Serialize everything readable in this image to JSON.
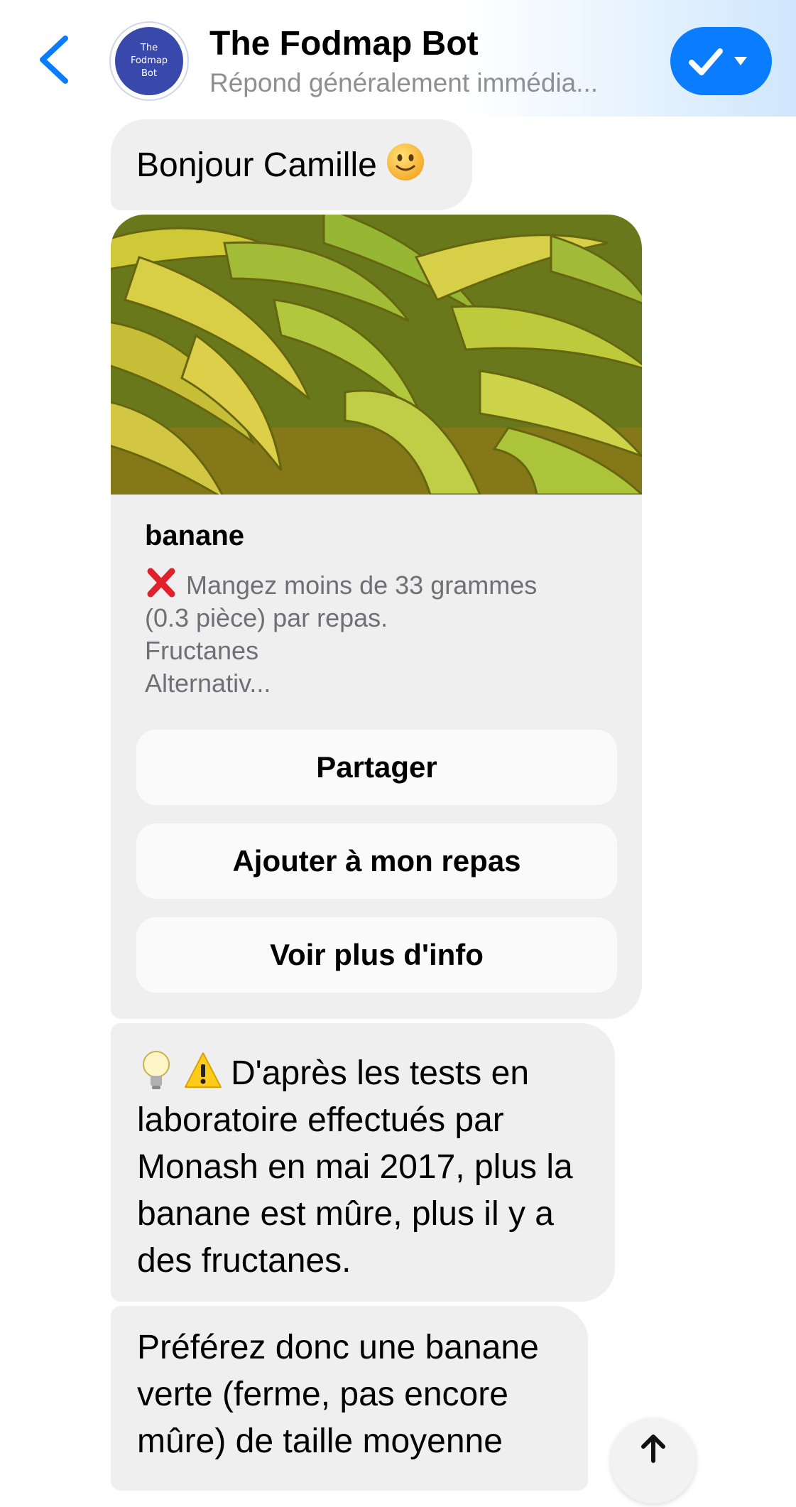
{
  "header": {
    "avatar_lines": [
      "The",
      "Fodmap",
      "Bot"
    ],
    "title": "The Fodmap Bot",
    "status": "Répond généralement immédia...",
    "icons": {
      "back": "chevron-left-icon",
      "action": "checkmark-dropdown-icon"
    },
    "accent_color": "#0a7cff"
  },
  "messages": {
    "greeting": {
      "text": "Bonjour Camille",
      "emoji": "slightly-smiling-face"
    },
    "card": {
      "image": "bananas-photo",
      "title": "banane",
      "subtitle_lines": [
        "Mangez moins de 33 grammes",
        "(0.3 pièce) par repas.",
        "Fructanes",
        "Alternativ..."
      ],
      "buttons": [
        "Partager",
        "Ajouter à mon repas",
        "Voir plus d'info"
      ]
    },
    "tip": {
      "lines": [
        "D'après les tests en",
        "laboratoire effectués par",
        "Monash en mai 2017, plus la",
        "banane est mûre, plus il y a",
        "des fructanes."
      ]
    },
    "preference": {
      "lines": [
        "Préférez donc une banane",
        "verte (ferme, pas encore",
        "mûre) de taille moyenne"
      ]
    }
  },
  "colors": {
    "bubble_bg": "#efefef",
    "accent": "#0a7cff",
    "avatar_bg": "#3949ab"
  }
}
